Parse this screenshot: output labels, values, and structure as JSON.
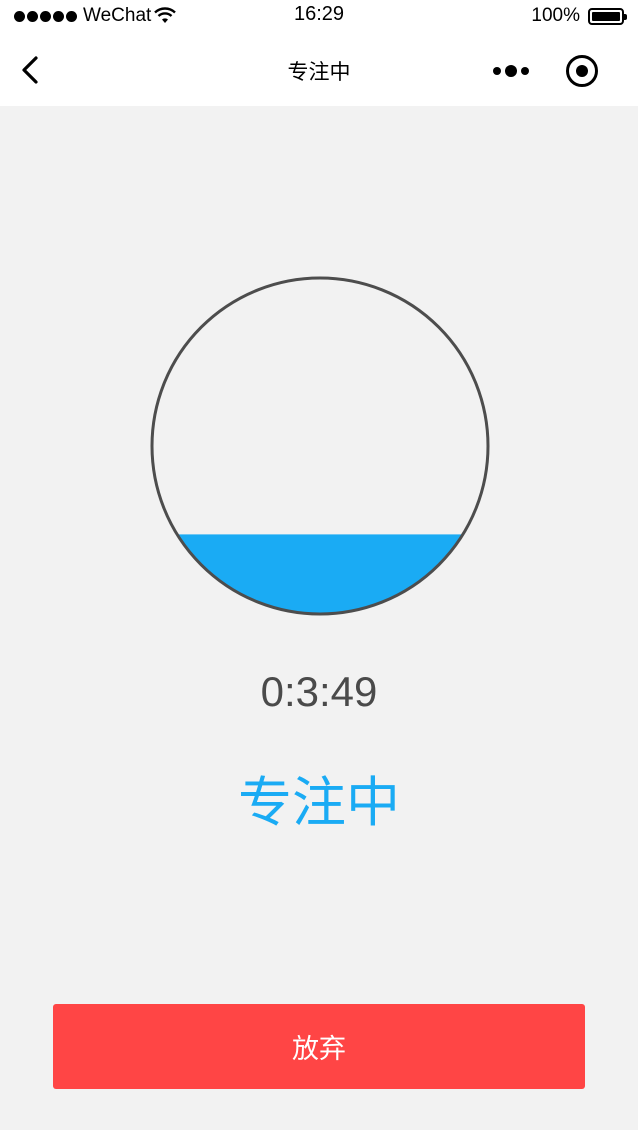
{
  "status_bar": {
    "carrier": "WeChat",
    "time": "16:29",
    "battery": "100%"
  },
  "nav": {
    "title": "专注中",
    "back_icon": "chevron-left-icon",
    "more_icon": "more-dots-icon",
    "close_icon": "capsule-close-icon"
  },
  "focus": {
    "elapsed": "0:3:49",
    "status": "专注中",
    "water_level": 0.24,
    "water_color": "#1aabf4"
  },
  "actions": {
    "give_up_label": "放弃",
    "give_up_color": "#ff4545"
  }
}
